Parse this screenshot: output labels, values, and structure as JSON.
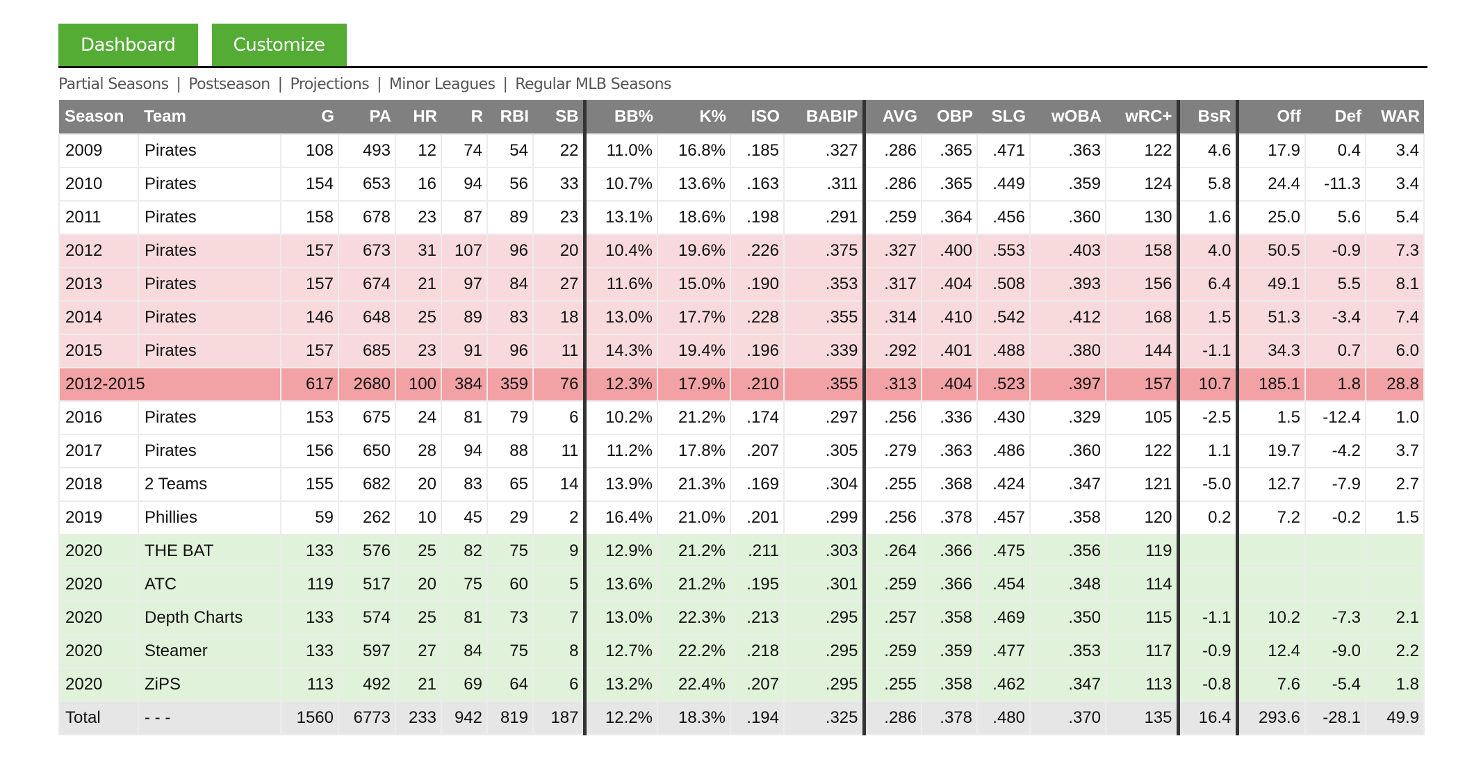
{
  "tabs": [
    {
      "label": "Dashboard"
    },
    {
      "label": "Customize"
    }
  ],
  "sublinks": [
    "Partial Seasons",
    "Postseason",
    "Projections",
    "Minor Leagues",
    "Regular MLB Seasons"
  ],
  "separator": "|",
  "colors": {
    "tab_green": "#54ac35",
    "header_gray": "#808080",
    "peak_row": "#f8dadc",
    "peak_summary_row": "#f2a2a5",
    "projection_row": "#e0f2da",
    "total_row": "#e6e6e6"
  },
  "table": {
    "columns": [
      "Season",
      "Team",
      "G",
      "PA",
      "HR",
      "R",
      "RBI",
      "SB",
      "BB%",
      "K%",
      "ISO",
      "BABIP",
      "AVG",
      "OBP",
      "SLG",
      "wOBA",
      "wRC+",
      "BsR",
      "Off",
      "Def",
      "WAR"
    ],
    "rows": [
      {
        "type": "base",
        "cells": [
          "2009",
          "Pirates",
          "108",
          "493",
          "12",
          "74",
          "54",
          "22",
          "11.0%",
          "16.8%",
          ".185",
          ".327",
          ".286",
          ".365",
          ".471",
          ".363",
          "122",
          "4.6",
          "17.9",
          "0.4",
          "3.4"
        ]
      },
      {
        "type": "base",
        "cells": [
          "2010",
          "Pirates",
          "154",
          "653",
          "16",
          "94",
          "56",
          "33",
          "10.7%",
          "13.6%",
          ".163",
          ".311",
          ".286",
          ".365",
          ".449",
          ".359",
          "124",
          "5.8",
          "24.4",
          "-11.3",
          "3.4"
        ]
      },
      {
        "type": "base",
        "cells": [
          "2011",
          "Pirates",
          "158",
          "678",
          "23",
          "87",
          "89",
          "23",
          "13.1%",
          "18.6%",
          ".198",
          ".291",
          ".259",
          ".364",
          ".456",
          ".360",
          "130",
          "1.6",
          "25.0",
          "5.6",
          "5.4"
        ]
      },
      {
        "type": "peak",
        "cells": [
          "2012",
          "Pirates",
          "157",
          "673",
          "31",
          "107",
          "96",
          "20",
          "10.4%",
          "19.6%",
          ".226",
          ".375",
          ".327",
          ".400",
          ".553",
          ".403",
          "158",
          "4.0",
          "50.5",
          "-0.9",
          "7.3"
        ]
      },
      {
        "type": "peak",
        "cells": [
          "2013",
          "Pirates",
          "157",
          "674",
          "21",
          "97",
          "84",
          "27",
          "11.6%",
          "15.0%",
          ".190",
          ".353",
          ".317",
          ".404",
          ".508",
          ".393",
          "156",
          "6.4",
          "49.1",
          "5.5",
          "8.1"
        ]
      },
      {
        "type": "peak",
        "cells": [
          "2014",
          "Pirates",
          "146",
          "648",
          "25",
          "89",
          "83",
          "18",
          "13.0%",
          "17.7%",
          ".228",
          ".355",
          ".314",
          ".410",
          ".542",
          ".412",
          "168",
          "1.5",
          "51.3",
          "-3.4",
          "7.4"
        ]
      },
      {
        "type": "peak",
        "cells": [
          "2015",
          "Pirates",
          "157",
          "685",
          "23",
          "91",
          "96",
          "11",
          "14.3%",
          "19.4%",
          ".196",
          ".339",
          ".292",
          ".401",
          ".488",
          ".380",
          "144",
          "-1.1",
          "34.3",
          "0.7",
          "6.0"
        ]
      },
      {
        "type": "peaksum",
        "cells": [
          "2012-2015",
          "",
          "617",
          "2680",
          "100",
          "384",
          "359",
          "76",
          "12.3%",
          "17.9%",
          ".210",
          ".355",
          ".313",
          ".404",
          ".523",
          ".397",
          "157",
          "10.7",
          "185.1",
          "1.8",
          "28.8"
        ]
      },
      {
        "type": "base",
        "cells": [
          "2016",
          "Pirates",
          "153",
          "675",
          "24",
          "81",
          "79",
          "6",
          "10.2%",
          "21.2%",
          ".174",
          ".297",
          ".256",
          ".336",
          ".430",
          ".329",
          "105",
          "-2.5",
          "1.5",
          "-12.4",
          "1.0"
        ]
      },
      {
        "type": "base",
        "cells": [
          "2017",
          "Pirates",
          "156",
          "650",
          "28",
          "94",
          "88",
          "11",
          "11.2%",
          "17.8%",
          ".207",
          ".305",
          ".279",
          ".363",
          ".486",
          ".360",
          "122",
          "1.1",
          "19.7",
          "-4.2",
          "3.7"
        ]
      },
      {
        "type": "base",
        "cells": [
          "2018",
          "2 Teams",
          "155",
          "682",
          "20",
          "83",
          "65",
          "14",
          "13.9%",
          "21.3%",
          ".169",
          ".304",
          ".255",
          ".368",
          ".424",
          ".347",
          "121",
          "-5.0",
          "12.7",
          "-7.9",
          "2.7"
        ]
      },
      {
        "type": "base",
        "cells": [
          "2019",
          "Phillies",
          "59",
          "262",
          "10",
          "45",
          "29",
          "2",
          "16.4%",
          "21.0%",
          ".201",
          ".299",
          ".256",
          ".378",
          ".457",
          ".358",
          "120",
          "0.2",
          "7.2",
          "-0.2",
          "1.5"
        ]
      },
      {
        "type": "proj",
        "cells": [
          "2020",
          "THE BAT",
          "133",
          "576",
          "25",
          "82",
          "75",
          "9",
          "12.9%",
          "21.2%",
          ".211",
          ".303",
          ".264",
          ".366",
          ".475",
          ".356",
          "119",
          "",
          "",
          "",
          ""
        ]
      },
      {
        "type": "proj",
        "cells": [
          "2020",
          "ATC",
          "119",
          "517",
          "20",
          "75",
          "60",
          "5",
          "13.6%",
          "21.2%",
          ".195",
          ".301",
          ".259",
          ".366",
          ".454",
          ".348",
          "114",
          "",
          "",
          "",
          ""
        ]
      },
      {
        "type": "proj",
        "cells": [
          "2020",
          "Depth Charts",
          "133",
          "574",
          "25",
          "81",
          "73",
          "7",
          "13.0%",
          "22.3%",
          ".213",
          ".295",
          ".257",
          ".358",
          ".469",
          ".350",
          "115",
          "-1.1",
          "10.2",
          "-7.3",
          "2.1"
        ]
      },
      {
        "type": "proj",
        "cells": [
          "2020",
          "Steamer",
          "133",
          "597",
          "27",
          "84",
          "75",
          "8",
          "12.7%",
          "22.2%",
          ".218",
          ".295",
          ".259",
          ".359",
          ".477",
          ".353",
          "117",
          "-0.9",
          "12.4",
          "-9.0",
          "2.2"
        ]
      },
      {
        "type": "proj",
        "cells": [
          "2020",
          "ZiPS",
          "113",
          "492",
          "21",
          "69",
          "64",
          "6",
          "13.2%",
          "22.4%",
          ".207",
          ".295",
          ".255",
          ".358",
          ".462",
          ".347",
          "113",
          "-0.8",
          "7.6",
          "-5.4",
          "1.8"
        ]
      },
      {
        "type": "total",
        "cells": [
          "Total",
          "- - -",
          "1560",
          "6773",
          "233",
          "942",
          "819",
          "187",
          "12.2%",
          "18.3%",
          ".194",
          ".325",
          ".286",
          ".378",
          ".480",
          ".370",
          "135",
          "16.4",
          "293.6",
          "-28.1",
          "49.9"
        ]
      }
    ]
  }
}
